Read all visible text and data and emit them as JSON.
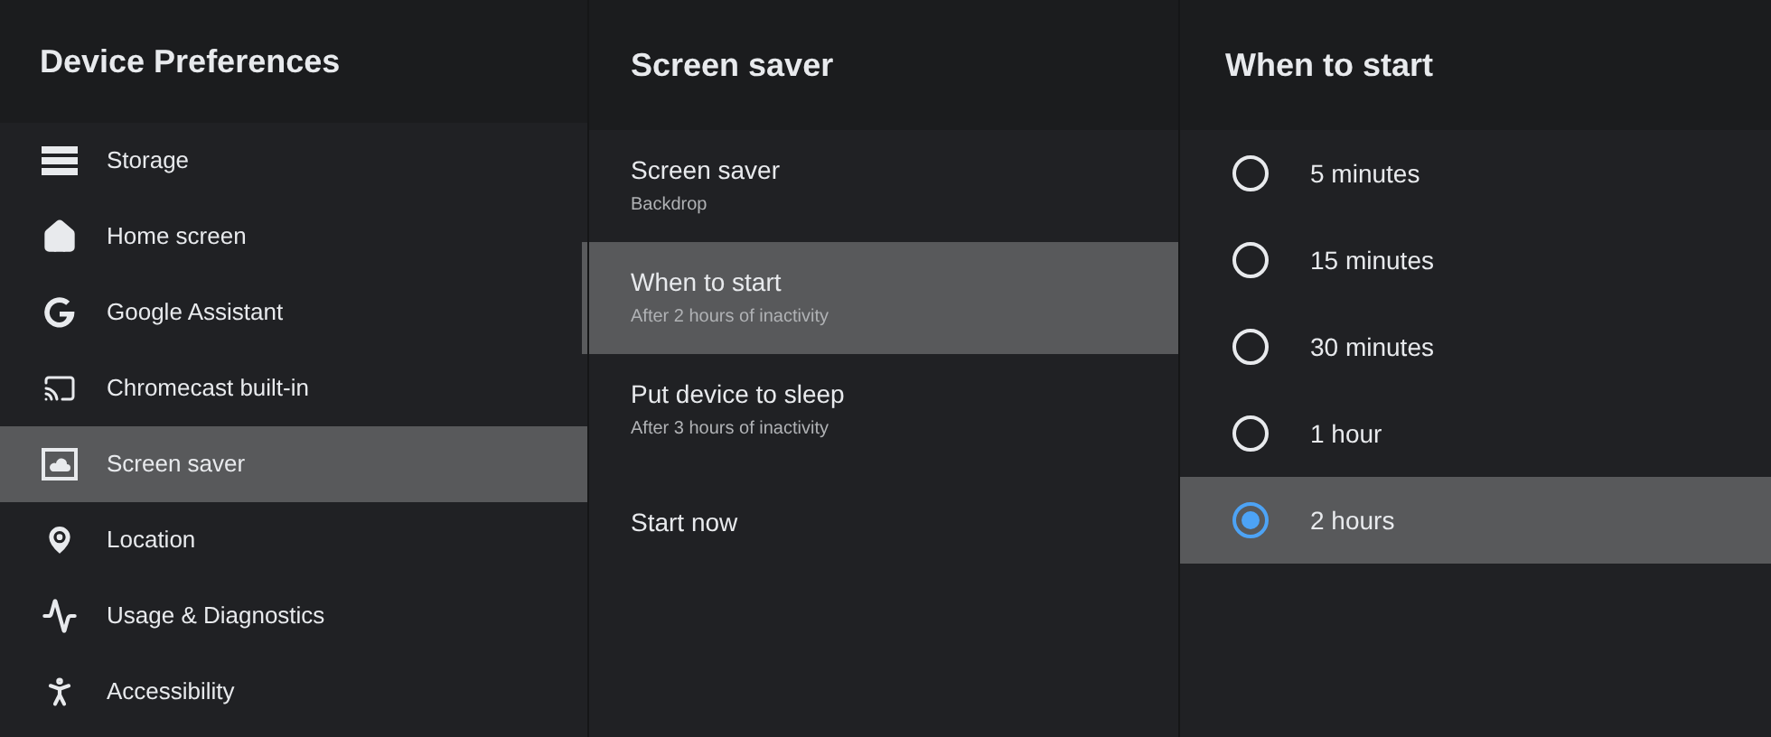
{
  "panels": [
    {
      "title": "Device Preferences",
      "items": [
        {
          "label": "Storage",
          "selected": false
        },
        {
          "label": "Home screen",
          "selected": false
        },
        {
          "label": "Google Assistant",
          "selected": false
        },
        {
          "label": "Chromecast built-in",
          "selected": false
        },
        {
          "label": "Screen saver",
          "selected": true
        },
        {
          "label": "Location",
          "selected": false
        },
        {
          "label": "Usage & Diagnostics",
          "selected": false
        },
        {
          "label": "Accessibility",
          "selected": false
        }
      ]
    },
    {
      "title": "Screen saver",
      "items": [
        {
          "label": "Screen saver",
          "summary": "Backdrop",
          "selected": false
        },
        {
          "label": "When to start",
          "summary": "After 2 hours of inactivity",
          "selected": true
        },
        {
          "label": "Put device to sleep",
          "summary": "After 3 hours of inactivity",
          "selected": false
        },
        {
          "label": "Start now",
          "selected": false
        }
      ]
    },
    {
      "title": "When to start",
      "options": [
        {
          "label": "5 minutes",
          "selected": false
        },
        {
          "label": "15 minutes",
          "selected": false
        },
        {
          "label": "30 minutes",
          "selected": false
        },
        {
          "label": "1 hour",
          "selected": false
        },
        {
          "label": "2 hours",
          "selected": true
        }
      ]
    }
  ]
}
